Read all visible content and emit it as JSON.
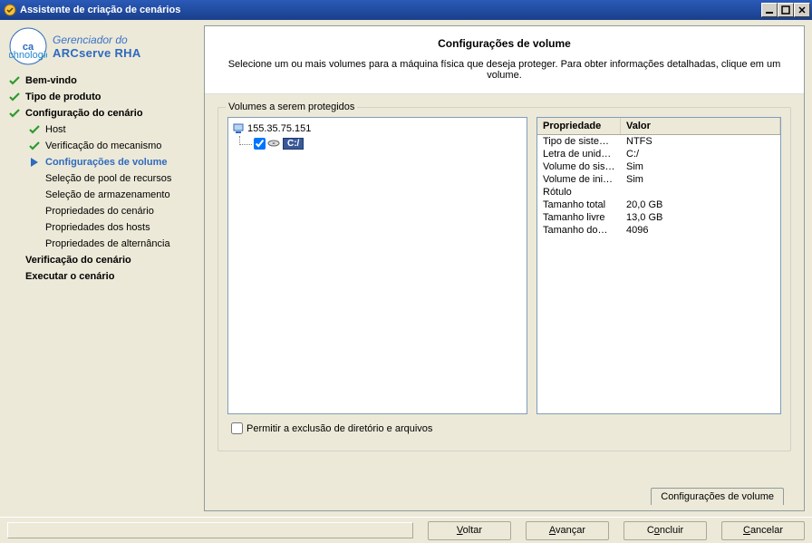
{
  "window": {
    "title": "Assistente de criação de cenários"
  },
  "brand": {
    "line1": "Gerenciador do",
    "line2": "ARCserve RHA"
  },
  "nav": {
    "welcome": "Bem-vindo",
    "productType": "Tipo de produto",
    "scenarioSetup": "Configuração do cenário",
    "host": "Host",
    "engineCheck": "Verificação do mecanismo",
    "volumeSettings": "Configurações de volume",
    "poolSelection": "Seleção de pool de recursos",
    "storageSelection": "Seleção de armazenamento",
    "scenarioProps": "Propriedades do cenário",
    "hostProps": "Propriedades dos hosts",
    "switchoverProps": "Propriedades de alternância",
    "scenarioVerify": "Verificação do cenário",
    "runScenario": "Executar o cenário"
  },
  "page": {
    "title": "Configurações de volume",
    "description": "Selecione um ou mais volumes para a máquina física que deseja proteger. Para obter informações detalhadas, clique em um volume."
  },
  "fieldset": {
    "legend": "Volumes a serem protegidos"
  },
  "tree": {
    "rootIp": "155.35.75.151",
    "driveLabel": "C:/"
  },
  "propHeader": {
    "key": "Propriedade",
    "value": "Valor"
  },
  "properties": [
    {
      "key": "Tipo de siste…",
      "value": "NTFS"
    },
    {
      "key": "Letra de unid…",
      "value": "C:/"
    },
    {
      "key": "Volume do sis…",
      "value": "Sim"
    },
    {
      "key": "Volume de ini…",
      "value": "Sim"
    },
    {
      "key": "Rótulo",
      "value": ""
    },
    {
      "key": "Tamanho total",
      "value": "20,0 GB"
    },
    {
      "key": "Tamanho livre",
      "value": "13,0 GB"
    },
    {
      "key": "Tamanho do…",
      "value": "4096"
    }
  ],
  "allowDelete": "Permitir a exclusão de diretório e arquivos",
  "tab": {
    "label": "Configurações de volume"
  },
  "buttons": {
    "back": "Voltar",
    "next": "Avançar",
    "finish": "Concluir",
    "cancel": "Cancelar"
  }
}
